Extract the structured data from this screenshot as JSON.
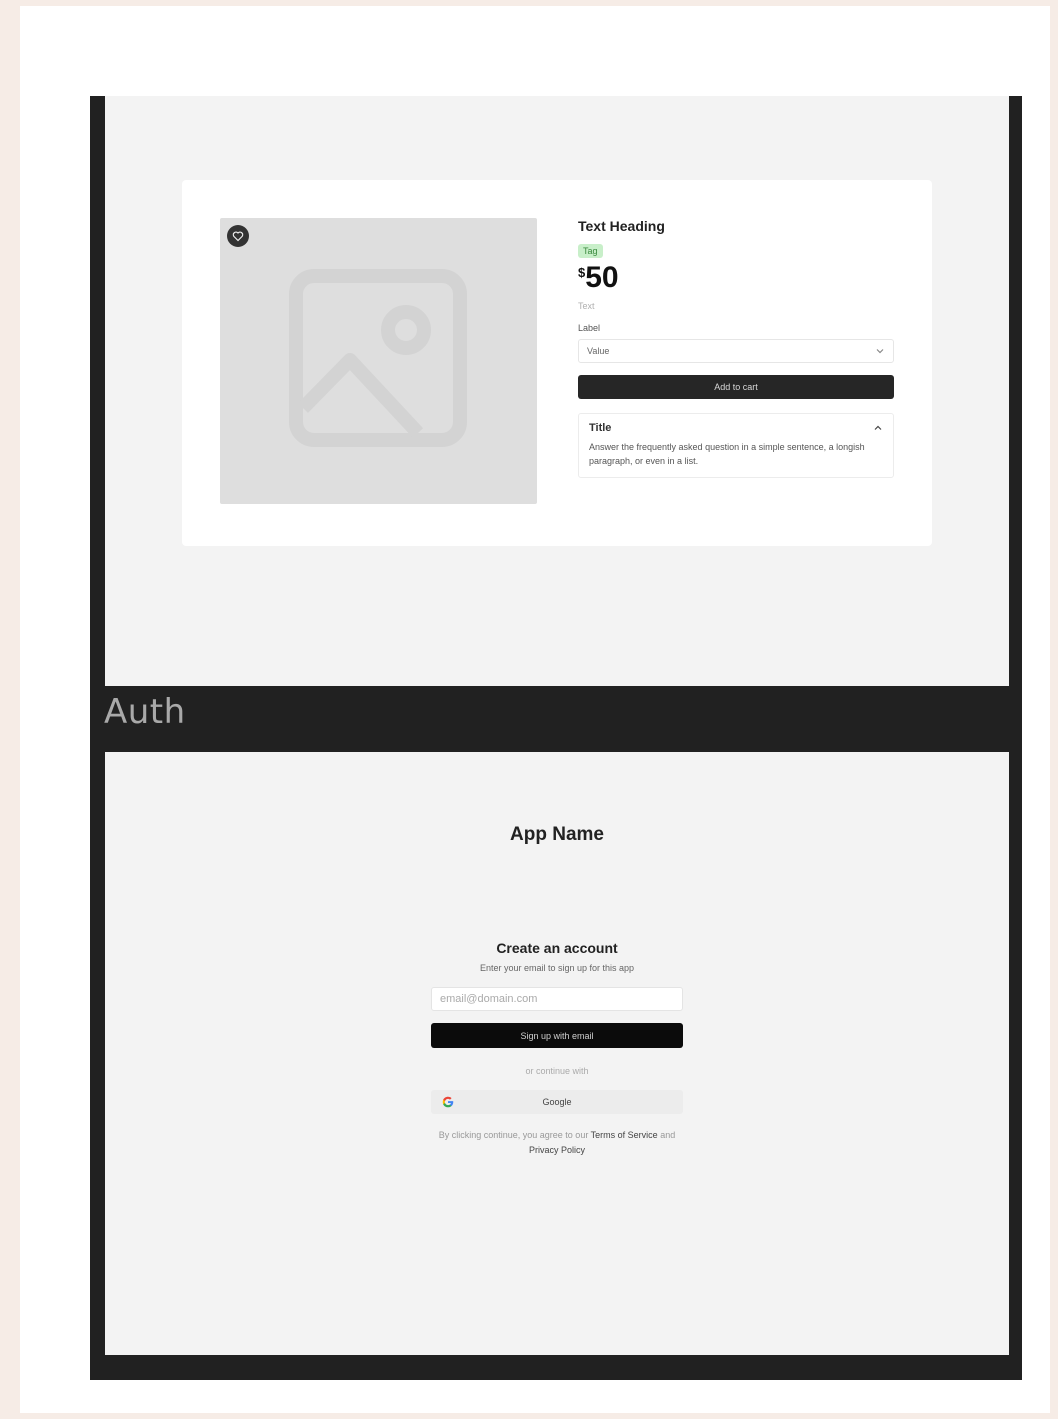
{
  "product": {
    "heading": "Text Heading",
    "tag": "Tag",
    "price_currency": "$",
    "price_amount": "50",
    "tax_note": "Text",
    "select_label": "Label",
    "select_value": "Value",
    "cart_button": "Add to cart",
    "accordion_title": "Title",
    "accordion_body": "Answer the frequently asked question in a simple sentence, a longish paragraph, or even in a list."
  },
  "section_label": "Auth",
  "auth": {
    "app_name": "App Name",
    "title": "Create an account",
    "subtitle": "Enter your email to sign up for this app",
    "email_placeholder": "email@domain.com",
    "signup_button": "Sign up with email",
    "divider_text": "or continue with",
    "google_button": "Google",
    "legal_prefix": "By clicking continue, you agree to our",
    "terms_link": "Terms of Service",
    "legal_and": "and",
    "privacy_link": "Privacy Policy"
  },
  "icons": {
    "image_placeholder": "image-icon",
    "favorite": "heart-icon",
    "select_chevron": "chevron-down-icon",
    "accordion_chevron": "chevron-up-icon",
    "google": "google-icon"
  },
  "colors": {
    "frame": "#212121",
    "panel": "#f3f3f3",
    "page_background": "#f6ece6",
    "primary_button": "#262626",
    "tag_background": "#c8efc9"
  }
}
